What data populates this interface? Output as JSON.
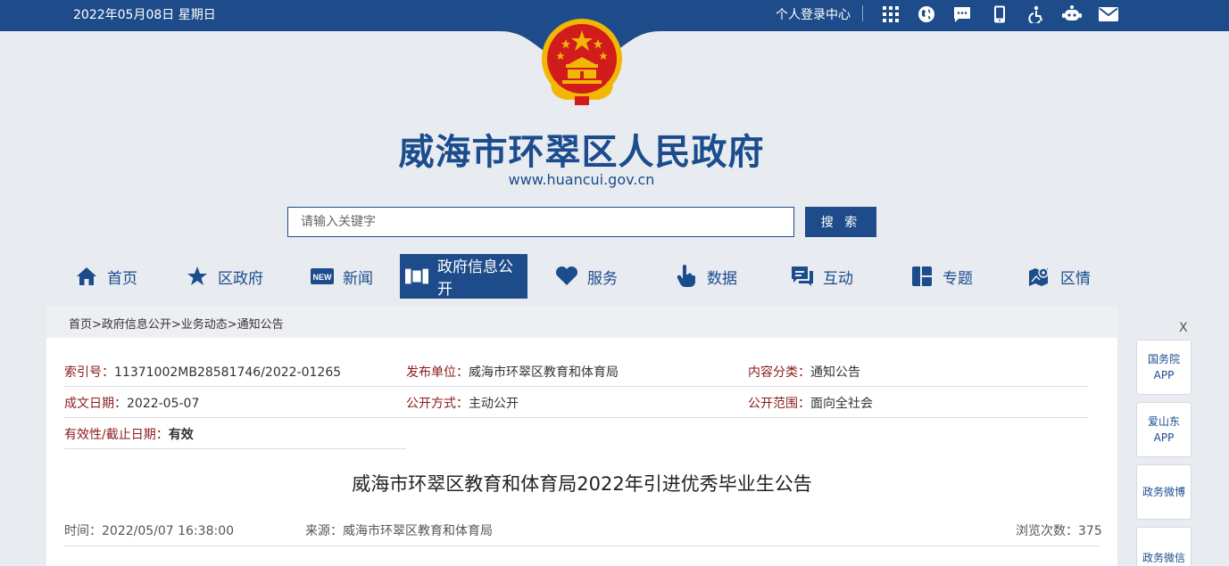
{
  "topbar": {
    "date": "2022年05月08日 星期日",
    "login": "个人登录中心",
    "icons": [
      "grid-icon",
      "globe-icon",
      "message-icon",
      "mobile-icon",
      "accessibility-icon",
      "robot-icon",
      "mail-icon"
    ]
  },
  "header": {
    "title": "威海市环翠区人民政府",
    "url": "www.huancui.gov.cn"
  },
  "search": {
    "placeholder": "请输入关键字",
    "button": "搜 索"
  },
  "nav": [
    {
      "label": "首页",
      "icon": "home-icon"
    },
    {
      "label": "区政府",
      "icon": "star-icon"
    },
    {
      "label": "新闻",
      "icon": "news-icon"
    },
    {
      "label": "政府信息公开",
      "icon": "open-info-icon"
    },
    {
      "label": "服务",
      "icon": "heart-icon"
    },
    {
      "label": "数据",
      "icon": "hand-pointer-icon"
    },
    {
      "label": "互动",
      "icon": "chat-icon"
    },
    {
      "label": "专题",
      "icon": "layout-icon"
    },
    {
      "label": "区情",
      "icon": "map-pin-icon"
    }
  ],
  "breadcrumb": "首页>政府信息公开>业务动态>通知公告",
  "meta": {
    "index_k": "索引号：",
    "index_v": "11371002MB28581746/2022-01265",
    "publisher_k": "发布单位：",
    "publisher_v": "威海市环翠区教育和体育局",
    "category_k": "内容分类：",
    "category_v": "通知公告",
    "date_k": "成文日期：",
    "date_v": "2022-05-07",
    "mode_k": "公开方式：",
    "mode_v": "主动公开",
    "scope_k": "公开范围：",
    "scope_v": "面向全社会",
    "valid_k": "有效性/截止日期：",
    "valid_v": "有效"
  },
  "article": {
    "title": "威海市环翠区教育和体育局2022年引进优秀毕业生公告",
    "time": "时间：2022/05/07 16:38:00",
    "source": "来源：威海市环翠区教育和体育局",
    "views": "浏览次数：375"
  },
  "side": {
    "close": "X",
    "items": [
      {
        "l1": "国务院",
        "l2": "APP"
      },
      {
        "l1": "爱山东",
        "l2": "APP"
      },
      {
        "l1": "政务微博",
        "l2": ""
      },
      {
        "l1": "政务微信",
        "l2": ""
      }
    ]
  },
  "colors": {
    "primary": "#1e4c8a",
    "emblem_red": "#d21c1c",
    "emblem_gold": "#f2b705"
  }
}
